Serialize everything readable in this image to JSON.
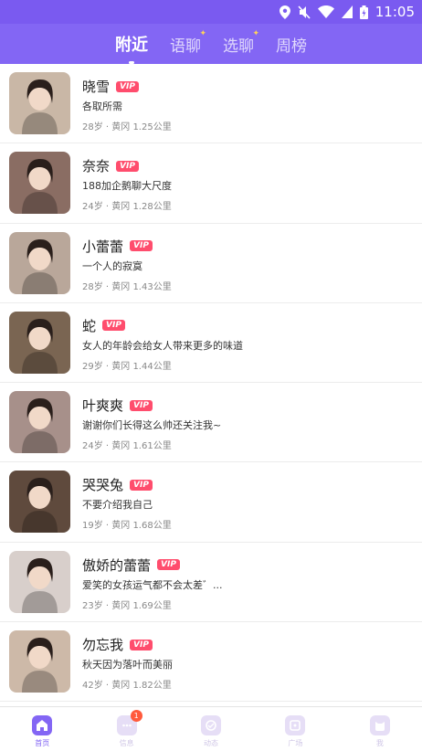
{
  "status_bar": {
    "time": "11:05"
  },
  "top_tabs": [
    {
      "label": "附近",
      "active": true
    },
    {
      "label": "语聊",
      "active": false
    },
    {
      "label": "选聊",
      "active": false
    },
    {
      "label": "周榜",
      "active": false
    }
  ],
  "vip_label": "VIP",
  "users": [
    {
      "name": "晓雪",
      "signature": "各取所需",
      "meta": "28岁 · 黄冈 1.25公里",
      "avatar_color": "#c9b7a6"
    },
    {
      "name": "奈奈",
      "signature": "188加企鹅聊大尺度",
      "meta": "24岁 · 黄冈 1.28公里",
      "avatar_color": "#8a6d63"
    },
    {
      "name": "小蕾蕾",
      "signature": "一个人的寂寞",
      "meta": "28岁 · 黄冈 1.43公里",
      "avatar_color": "#b9a79a"
    },
    {
      "name": "蛇",
      "signature": "女人的年龄会给女人带来更多的味道",
      "meta": "29岁 · 黄冈 1.44公里",
      "avatar_color": "#7a6552"
    },
    {
      "name": "叶爽爽",
      "signature": "谢谢你们长得这么帅还关注我~",
      "meta": "24岁 · 黄冈 1.61公里",
      "avatar_color": "#a7908a"
    },
    {
      "name": "哭哭兔",
      "signature": "不要介绍我自己",
      "meta": "19岁 · 黄冈 1.68公里",
      "avatar_color": "#5f4a3d"
    },
    {
      "name": "傲娇的蕾蕾",
      "signature": "爱笑的女孩运气都不会太差゛...",
      "meta": "23岁 · 黄冈 1.69公里",
      "avatar_color": "#d8cfcb"
    },
    {
      "name": "勿忘我",
      "signature": "秋天因为落叶而美丽",
      "meta": "42岁 · 黄冈 1.82公里",
      "avatar_color": "#cdb9a8"
    }
  ],
  "bottom_nav": [
    {
      "label": "首页",
      "icon": "home-icon",
      "active": true,
      "badge": ""
    },
    {
      "label": "信息",
      "icon": "message-icon",
      "active": false,
      "badge": "1"
    },
    {
      "label": "动态",
      "icon": "moments-icon",
      "active": false,
      "badge": ""
    },
    {
      "label": "广场",
      "icon": "plaza-icon",
      "active": false,
      "badge": ""
    },
    {
      "label": "我",
      "icon": "profile-icon",
      "active": false,
      "badge": ""
    }
  ],
  "colors": {
    "brand": "#8366f4",
    "vip": "#ff4d6d",
    "badge": "#ff5a3c"
  }
}
